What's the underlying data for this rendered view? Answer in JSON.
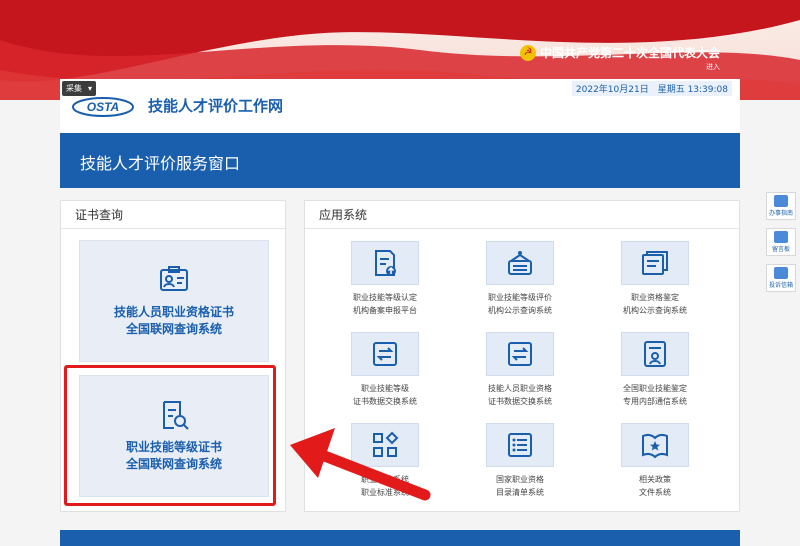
{
  "banner": {
    "party_text": "中国共产党第二十次全国代表大会",
    "party_sub": "进入"
  },
  "header": {
    "collect_label": "采集",
    "logo_text": "OSTA",
    "site_title": "技能人才评价工作网",
    "datetime": "2022年10月21日　星期五 13:39:08"
  },
  "bluebar": {
    "title": "技能人才评价服务窗口"
  },
  "cert_panel": {
    "title": "证书查询",
    "cards": [
      {
        "line1": "技能人员职业资格证书",
        "line2": "全国联网查询系统",
        "icon": "certificate-person-icon"
      },
      {
        "line1": "职业技能等级证书",
        "line2": "全国联网查询系统",
        "icon": "certificate-search-icon"
      }
    ]
  },
  "apps_panel": {
    "title": "应用系统",
    "apps": [
      {
        "line1": "职业技能等级认定",
        "line2": "机构备案申报平台",
        "icon": "document-upload-icon"
      },
      {
        "line1": "职业技能等级评价",
        "line2": "机构公示查询系统",
        "icon": "notice-board-icon"
      },
      {
        "line1": "职业资格鉴定",
        "line2": "机构公示查询系统",
        "icon": "document-stack-icon"
      },
      {
        "line1": "职业技能等级",
        "line2": "证书数据交换系统",
        "icon": "exchange-icon"
      },
      {
        "line1": "技能人员职业资格",
        "line2": "证书数据交换系统",
        "icon": "exchange-icon"
      },
      {
        "line1": "全国职业技能鉴定",
        "line2": "专用内部通信系统",
        "icon": "contact-card-icon"
      },
      {
        "line1": "职业标准系统",
        "line2": "职业标准系统",
        "icon": "grid-diamond-icon"
      },
      {
        "line1": "国家职业资格",
        "line2": "目录清单系统",
        "icon": "list-icon"
      },
      {
        "line1": "相关政策",
        "line2": "文件系统",
        "icon": "policy-book-icon"
      }
    ]
  },
  "sidebar": {
    "items": [
      {
        "label": "办事指南",
        "icon": "map-icon"
      },
      {
        "label": "留言板",
        "icon": "chat-icon"
      },
      {
        "label": "投诉信箱",
        "icon": "mail-icon"
      }
    ]
  },
  "colors": {
    "brand_blue": "#1a5fae",
    "annotation_red": "#e21a1a"
  }
}
